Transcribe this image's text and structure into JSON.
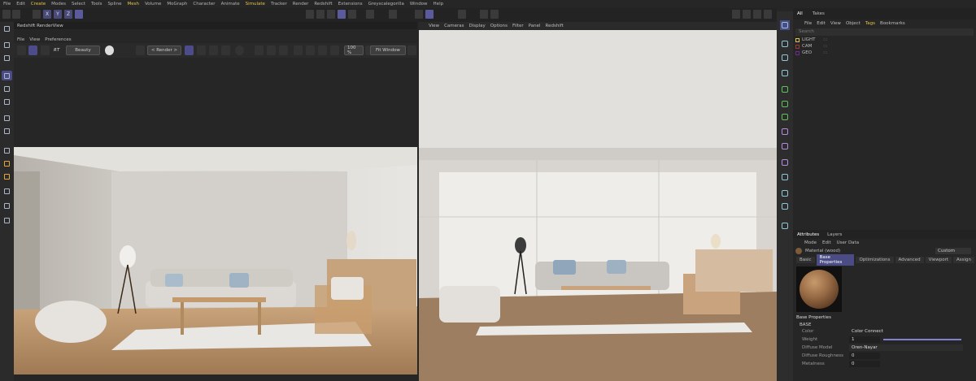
{
  "menubar": {
    "items": [
      "File",
      "Edit",
      "Create",
      "Modes",
      "Select",
      "Tools",
      "Spline",
      "Mesh",
      "Volume",
      "MoGraph",
      "Character",
      "Animate",
      "Simulate",
      "Tracker",
      "Render",
      "Redshift",
      "Extensions",
      "Greyscalegorilla",
      "Window",
      "Help"
    ],
    "highlighted": [
      "Create",
      "Mesh",
      "Simulate"
    ]
  },
  "toolbar": {
    "axis_labels": [
      "X",
      "Y",
      "Z"
    ]
  },
  "renderview": {
    "tab_title": "Redshift RenderView",
    "menu": [
      "File",
      "View",
      "Preferences"
    ],
    "rt_label": "RT",
    "quality_select": "Beauty",
    "render_select": "< Render >",
    "zoom": "100 %",
    "fit_select": "Fit Window"
  },
  "viewport": {
    "menu": [
      "View",
      "Cameras",
      "Display",
      "Options",
      "Filter",
      "Panel",
      "Redshift"
    ]
  },
  "object_manager": {
    "tabs": [
      "All",
      "Takes"
    ],
    "menu": [
      "File",
      "Edit",
      "View",
      "Object",
      "Tags",
      "Bookmarks"
    ],
    "highlighted_menu": "Tags",
    "search_placeholder": "Search",
    "rows": [
      {
        "name": "LIGHT",
        "color": "#d9c54a"
      },
      {
        "name": "CAM",
        "color": "#9a3b3b"
      },
      {
        "name": "GEO",
        "color": "#6b2b8a"
      }
    ]
  },
  "attributes": {
    "tabs": [
      "Attributes",
      "Layers"
    ],
    "menu": [
      "Mode",
      "Edit",
      "User Data"
    ],
    "material_name": "Material (wood)",
    "preset": "Custom",
    "sub_tabs": [
      "Basic",
      "Base Properties",
      "Optimizations",
      "Advanced",
      "Viewport",
      "Assign"
    ],
    "active_sub_tab": "Base Properties",
    "section_title": "Base Properties",
    "group_title": "BASE",
    "properties": [
      {
        "label": "Color",
        "value": "Color Connect"
      },
      {
        "label": "Weight",
        "value": "1"
      },
      {
        "label": "Diffuse Model",
        "value": "Oren-Nayar"
      },
      {
        "label": "Diffuse Roughness",
        "value": "0"
      },
      {
        "label": "Metalness",
        "value": "0"
      }
    ],
    "weight_fraction": 1.0
  },
  "colors": {
    "accent": "#4b4b86",
    "highlight_text": "#e6c34a",
    "panel_bg": "#262626"
  }
}
